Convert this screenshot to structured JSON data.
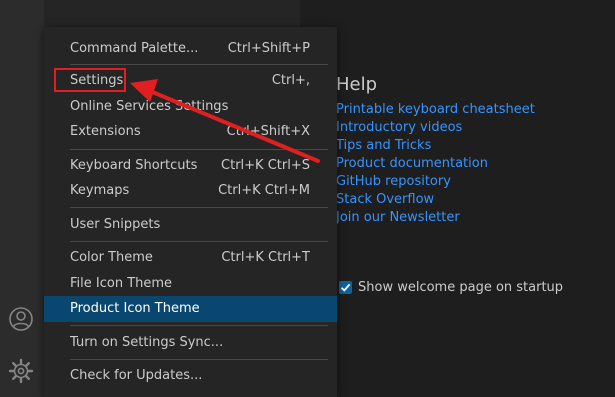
{
  "activity_bar": {
    "icons": [
      "account-icon",
      "gear-icon"
    ]
  },
  "help": {
    "title": "Help",
    "links": [
      "Printable keyboard cheatsheet",
      "Introductory videos",
      "Tips and Tricks",
      "Product documentation",
      "GitHub repository",
      "Stack Overflow",
      "Join our Newsletter"
    ],
    "startup_label": "Show welcome page on startup",
    "startup_checked": true
  },
  "menu": {
    "items": [
      {
        "label": "Command Palette...",
        "shortcut": "Ctrl+Shift+P"
      },
      {
        "label": "Settings",
        "shortcut": "Ctrl+,"
      },
      {
        "label": "Online Services Settings",
        "shortcut": ""
      },
      {
        "label": "Extensions",
        "shortcut": "Ctrl+Shift+X"
      },
      {
        "label": "Keyboard Shortcuts",
        "shortcut": "Ctrl+K Ctrl+S"
      },
      {
        "label": "Keymaps",
        "shortcut": "Ctrl+K Ctrl+M"
      },
      {
        "label": "User Snippets",
        "shortcut": ""
      },
      {
        "label": "Color Theme",
        "shortcut": "Ctrl+K Ctrl+T"
      },
      {
        "label": "File Icon Theme",
        "shortcut": ""
      },
      {
        "label": "Product Icon Theme",
        "shortcut": ""
      },
      {
        "label": "Turn on Settings Sync...",
        "shortcut": ""
      },
      {
        "label": "Check for Updates...",
        "shortcut": ""
      }
    ],
    "active_item": "Product Icon Theme"
  },
  "annotation": {
    "highlighted_item": "Settings",
    "color": "#e02020"
  },
  "colors": {
    "link": "#3794ff",
    "menu_active": "#094771",
    "checkbox": "#0e639c"
  }
}
